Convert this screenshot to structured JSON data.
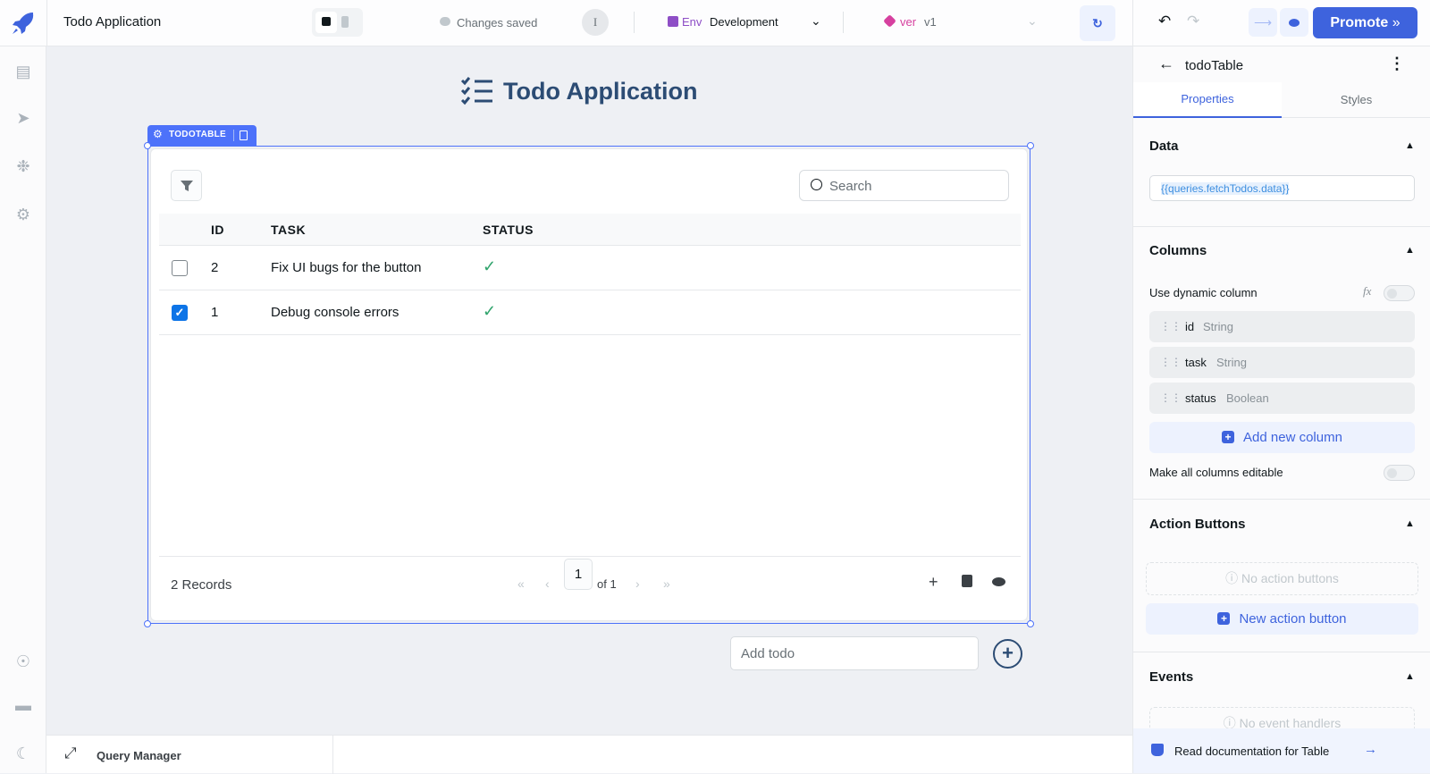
{
  "topbar": {
    "app_title": "Todo Application",
    "save_status": "Changes saved",
    "avatar_initial": "I",
    "env_label": "Env",
    "env_value": "Development",
    "ver_label": "ver",
    "ver_value": "v1",
    "promote_label": "Promote"
  },
  "sidebar": {
    "items": [
      "pages-icon",
      "inspector-icon",
      "debugger-icon",
      "settings-icon"
    ],
    "bottom": [
      "support-icon",
      "chat-icon",
      "dark-mode-icon"
    ]
  },
  "canvas": {
    "title": "Todo Application",
    "widget_tag": "TODOTABLE",
    "table": {
      "search_placeholder": "Search",
      "columns": [
        "ID",
        "TASK",
        "STATUS"
      ],
      "rows": [
        {
          "id": "2",
          "task": "Fix UI bugs for the button",
          "status": true,
          "selected": false
        },
        {
          "id": "1",
          "task": "Debug console errors",
          "status": true,
          "selected": true
        }
      ],
      "records": "2 Records",
      "page": "1",
      "of_pages": "of 1"
    },
    "add_todo_placeholder": "Add todo"
  },
  "query_manager": {
    "label": "Query Manager"
  },
  "panel": {
    "component_name": "todoTable",
    "tabs": [
      "Properties",
      "Styles"
    ],
    "data": {
      "heading": "Data",
      "value": "{{queries.fetchTodos.data}}"
    },
    "columns": {
      "heading": "Columns",
      "dynamic_label": "Use dynamic column",
      "fx": "fx",
      "items": [
        {
          "name": "id",
          "type": "String"
        },
        {
          "name": "task",
          "type": "String"
        },
        {
          "name": "status",
          "type": "Boolean"
        }
      ],
      "add_label": "Add new column",
      "editable_label": "Make all columns editable"
    },
    "actions": {
      "heading": "Action Buttons",
      "empty": "No action buttons",
      "add_label": "New action button"
    },
    "events": {
      "heading": "Events",
      "empty": "No event handlers"
    },
    "docs": "Read documentation for Table"
  },
  "colors": {
    "accent": "#3e63dd",
    "success": "#30a46c"
  }
}
